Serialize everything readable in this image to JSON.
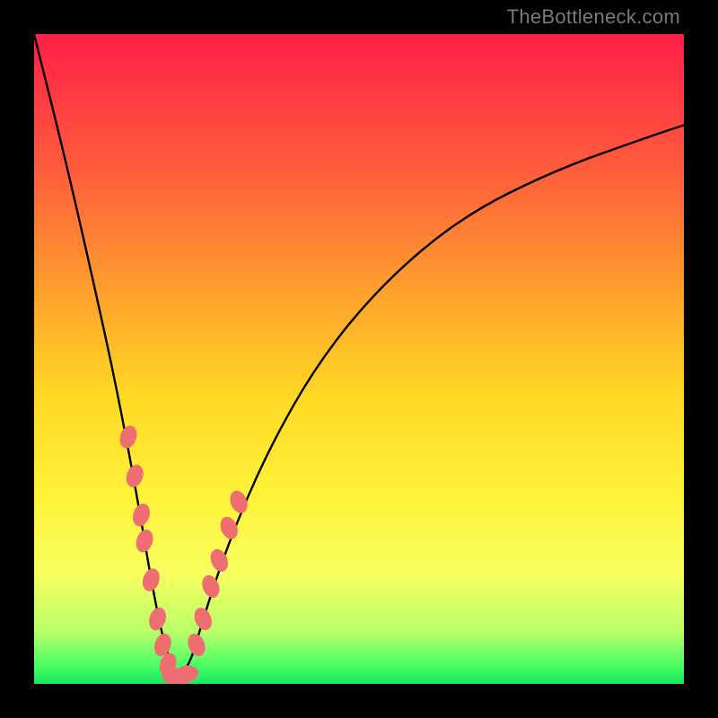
{
  "watermark": "TheBottleneck.com",
  "chart_data": {
    "type": "line",
    "title": "",
    "xlabel": "",
    "ylabel": "",
    "xlim": [
      0,
      100
    ],
    "ylim": [
      0,
      100
    ],
    "series": [
      {
        "name": "bottleneck-curve",
        "x": [
          0,
          5,
          10,
          13,
          16,
          18,
          20,
          22,
          24,
          26,
          30,
          36,
          44,
          54,
          66,
          80,
          94,
          100
        ],
        "values": [
          100,
          80,
          58,
          44,
          28,
          16,
          6,
          1,
          3,
          10,
          22,
          36,
          50,
          62,
          72,
          79,
          84,
          86
        ]
      }
    ],
    "marker_clusters": [
      {
        "name": "left-descent-markers",
        "color": "#ee6e72",
        "points": [
          {
            "x": 14.5,
            "y": 38
          },
          {
            "x": 15.5,
            "y": 32
          },
          {
            "x": 16.5,
            "y": 26
          },
          {
            "x": 17.0,
            "y": 22
          },
          {
            "x": 18.0,
            "y": 16
          },
          {
            "x": 19.0,
            "y": 10
          },
          {
            "x": 19.8,
            "y": 6
          },
          {
            "x": 20.6,
            "y": 3
          }
        ]
      },
      {
        "name": "valley-markers",
        "color": "#ee6e72",
        "points": [
          {
            "x": 21.5,
            "y": 1.2
          },
          {
            "x": 22.5,
            "y": 1.0
          },
          {
            "x": 23.5,
            "y": 1.6
          }
        ]
      },
      {
        "name": "right-ascent-markers",
        "color": "#ee6e72",
        "points": [
          {
            "x": 25.0,
            "y": 6
          },
          {
            "x": 26.0,
            "y": 10
          },
          {
            "x": 27.2,
            "y": 15
          },
          {
            "x": 28.5,
            "y": 19
          },
          {
            "x": 30.0,
            "y": 24
          },
          {
            "x": 31.5,
            "y": 28
          }
        ]
      }
    ]
  }
}
